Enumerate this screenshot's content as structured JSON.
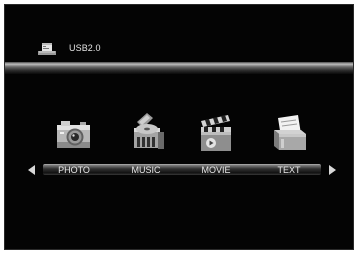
{
  "header": {
    "device_label": "USB2.0",
    "device_icon": "usb-drive-icon"
  },
  "menu": {
    "items": [
      {
        "label": "PHOTO",
        "icon": "camera-icon"
      },
      {
        "label": "MUSIC",
        "icon": "music-disc-icon"
      },
      {
        "label": "MOVIE",
        "icon": "clapperboard-icon"
      },
      {
        "label": "TEXT",
        "icon": "document-tray-icon"
      }
    ]
  },
  "colors": {
    "background": "#040404",
    "text": "#e8e8e8",
    "bar_highlight": "#bdbdbd"
  }
}
